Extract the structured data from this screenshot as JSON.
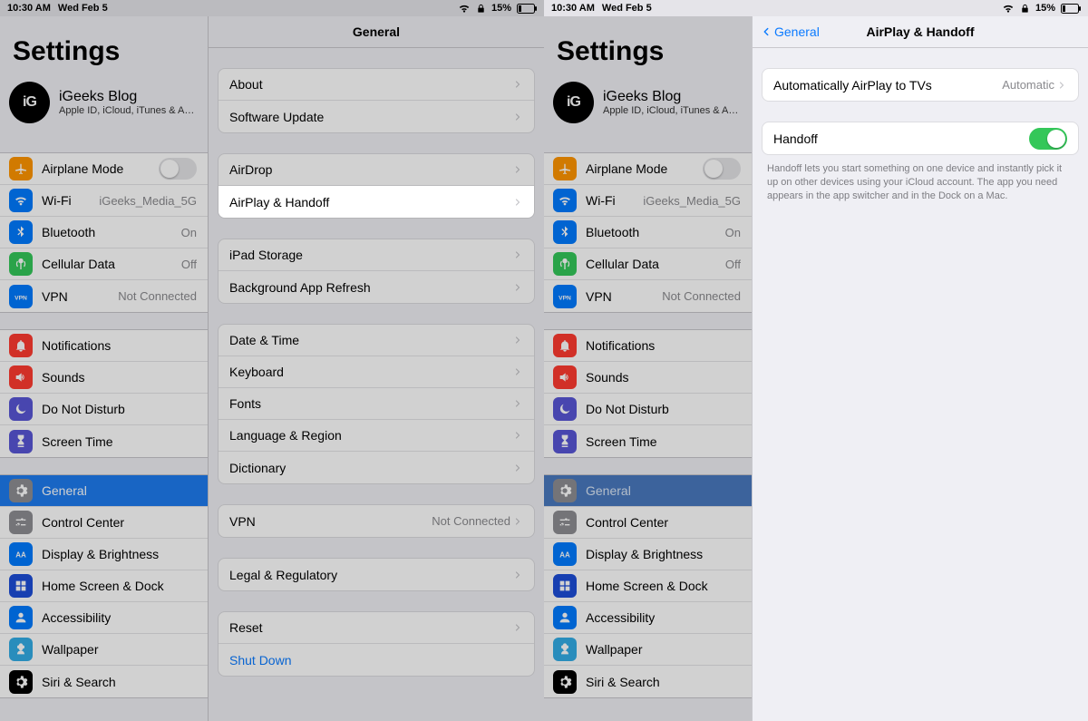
{
  "status": {
    "time": "10:30 AM",
    "date": "Wed Feb 5",
    "battery_pct": "15%"
  },
  "sidebar": {
    "title": "Settings",
    "account": {
      "avatar_text": "iG",
      "name": "iGeeks Blog",
      "sub": "Apple ID, iCloud, iTunes & App St..."
    },
    "g1": [
      {
        "label": "Airplane Mode",
        "value": "",
        "icon": "airplane",
        "bg": "bg-orange",
        "switch": true
      },
      {
        "label": "Wi-Fi",
        "value": "iGeeks_Media_5G",
        "icon": "wifi",
        "bg": "bg-blue"
      },
      {
        "label": "Bluetooth",
        "value": "On",
        "icon": "bluetooth",
        "bg": "bg-blue"
      },
      {
        "label": "Cellular Data",
        "value": "Off",
        "icon": "antenna",
        "bg": "bg-green"
      },
      {
        "label": "VPN",
        "value": "Not Connected",
        "icon": "vpn",
        "bg": "bg-blue"
      }
    ],
    "g2": [
      {
        "label": "Notifications",
        "icon": "bell",
        "bg": "bg-red"
      },
      {
        "label": "Sounds",
        "icon": "speaker",
        "bg": "bg-red"
      },
      {
        "label": "Do Not Disturb",
        "icon": "moon",
        "bg": "bg-purple"
      },
      {
        "label": "Screen Time",
        "icon": "hourglass",
        "bg": "bg-purple"
      }
    ],
    "g3": [
      {
        "label": "General",
        "icon": "gear",
        "bg": "bg-gray",
        "selected": true
      },
      {
        "label": "Control Center",
        "icon": "sliders",
        "bg": "bg-gray"
      },
      {
        "label": "Display & Brightness",
        "icon": "aa",
        "bg": "bg-blue"
      },
      {
        "label": "Home Screen & Dock",
        "icon": "grid",
        "bg": "bg-darkblue"
      },
      {
        "label": "Accessibility",
        "icon": "person",
        "bg": "bg-blue"
      },
      {
        "label": "Wallpaper",
        "icon": "flower",
        "bg": "bg-cyan"
      },
      {
        "label": "Siri & Search",
        "icon": "siri",
        "bg": "bg-black"
      }
    ]
  },
  "general": {
    "title": "General",
    "sections": {
      "a": [
        "About",
        "Software Update"
      ],
      "b": [
        "AirDrop",
        "AirPlay & Handoff"
      ],
      "c": [
        "iPad Storage",
        "Background App Refresh"
      ],
      "d": [
        "Date & Time",
        "Keyboard",
        "Fonts",
        "Language & Region",
        "Dictionary"
      ],
      "e_label": "VPN",
      "e_value": "Not Connected",
      "f": [
        "Legal & Regulatory"
      ],
      "g": [
        "Reset",
        "Shut Down"
      ]
    }
  },
  "airplay": {
    "back": "General",
    "title": "AirPlay & Handoff",
    "row1_label": "Automatically AirPlay to TVs",
    "row1_value": "Automatic",
    "row2_label": "Handoff",
    "note": "Handoff lets you start something on one device and instantly pick it up on other devices using your iCloud account. The app you need appears in the app switcher and in the Dock on a Mac."
  }
}
